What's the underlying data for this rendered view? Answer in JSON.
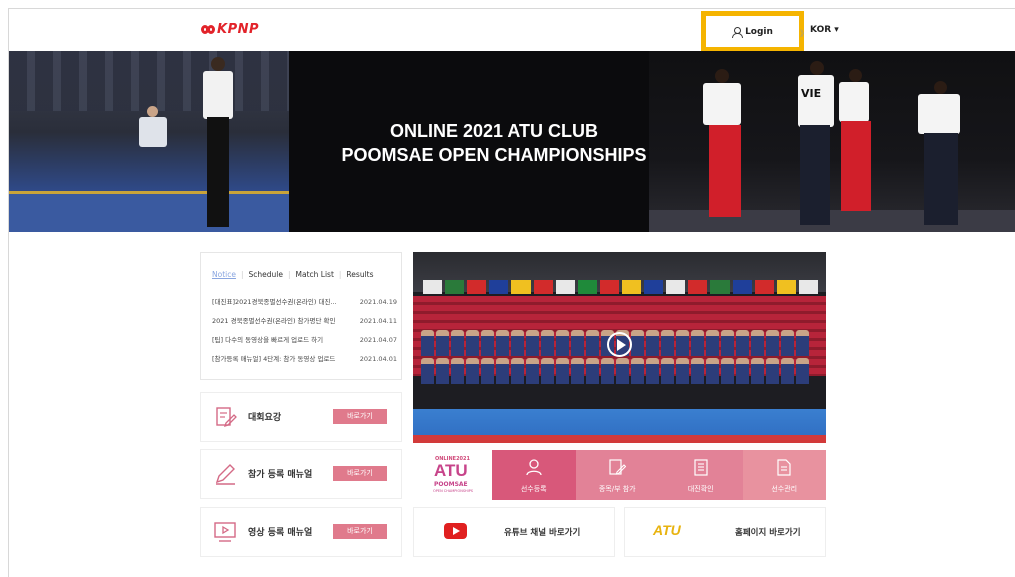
{
  "header": {
    "logo_text": "KPNP",
    "login_label": "Login",
    "separator": "》",
    "language": "KOR ▾",
    "brand_color": "#e2232a",
    "highlight_color": "#f5b400"
  },
  "hero": {
    "title_line1": "ONLINE 2021 ATU CLUB",
    "title_line2": "POOMSAE OPEN CHAMPIONSHIPS",
    "team_tag": "VIE"
  },
  "notice": {
    "tabs": [
      "Notice",
      "Schedule",
      "Match List",
      "Results"
    ],
    "items": [
      {
        "title": "[대진표]2021경북종별선수권(온라인) 대진...",
        "date": "2021.04.19"
      },
      {
        "title": "2021 경북종별선수권(온라인) 참가명단 확인",
        "date": "2021.04.11"
      },
      {
        "title": "[팁] 다수의 동영상을 빠르게 업로드 하기",
        "date": "2021.04.07"
      },
      {
        "title": "[참가등록 매뉴얼] 4단계: 참가 동영상 업로드",
        "date": "2021.04.01"
      }
    ]
  },
  "menu_cards": [
    {
      "label": "대회요강",
      "button": "바로가기",
      "icon": "edit-document-icon"
    },
    {
      "label": "참가 등록 매뉴얼",
      "button": "바로가기",
      "icon": "pencil-icon"
    },
    {
      "label": "영상 등록 매뉴얼",
      "button": "바로가기",
      "icon": "video-screen-icon"
    }
  ],
  "quick_logo": {
    "small": "ONLINE2021",
    "big": "ATU",
    "mid": "POOMSAE",
    "sub": "OPEN CHAMPIONSHIPS"
  },
  "quick_links": [
    {
      "label": "선수등록",
      "icon": "person-icon",
      "color": "#d8587a"
    },
    {
      "label": "종목/부 참가",
      "icon": "edit-icon",
      "color": "#e28297"
    },
    {
      "label": "대진확인",
      "icon": "clipboard-list-icon",
      "color": "#e28297"
    },
    {
      "label": "선수관리",
      "icon": "document-icon",
      "color": "#e8929f"
    }
  ],
  "bottom_links": {
    "youtube_label": "유튜브 채널 바로가기",
    "homepage_label": "홈페이지 바로가기",
    "atu_text": "ATU"
  }
}
